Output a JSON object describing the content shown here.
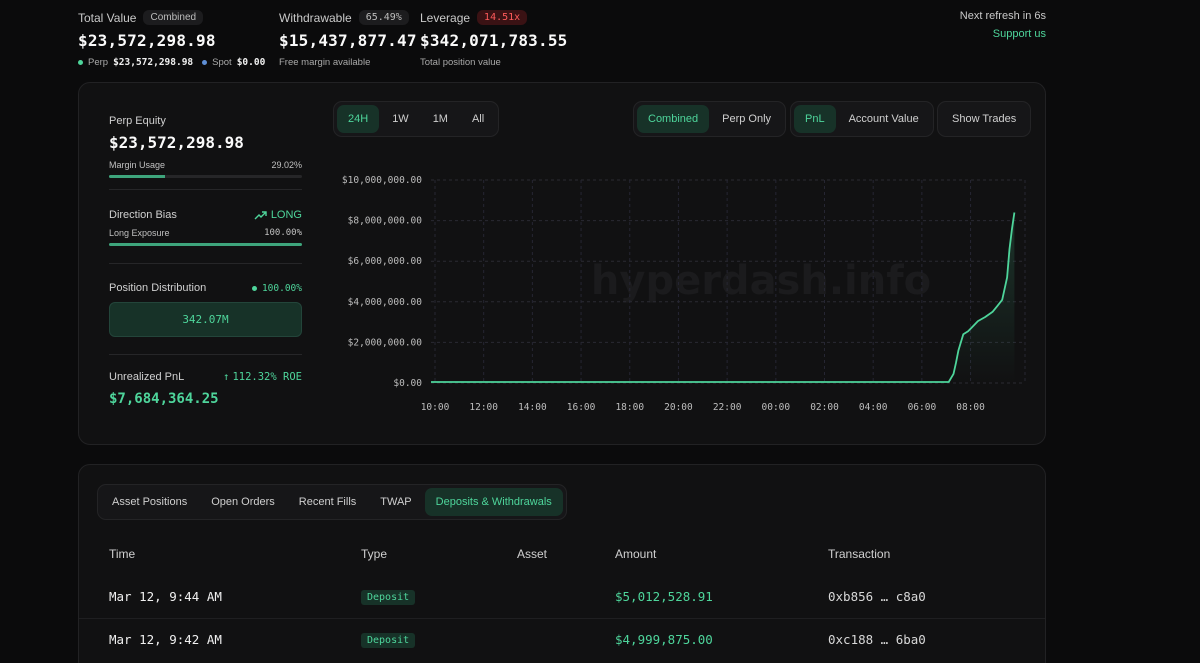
{
  "summary": {
    "total_value": {
      "label": "Total Value",
      "badge": "Combined",
      "value": "$23,572,298.98",
      "perp_label": "Perp",
      "perp_value": "$23,572,298.98",
      "spot_label": "Spot",
      "spot_value": "$0.00"
    },
    "withdrawable": {
      "label": "Withdrawable",
      "badge": "65.49%",
      "value": "$15,437,877.47",
      "sub": "Free margin available"
    },
    "leverage": {
      "label": "Leverage",
      "badge": "14.51x",
      "value": "$342,071,783.55",
      "sub": "Total position value"
    },
    "refresh": "Next refresh in 6s",
    "support": "Support us"
  },
  "equity": {
    "label": "Perp Equity",
    "value": "$23,572,298.98",
    "margin_label": "Margin Usage",
    "margin_value": "29.02%",
    "margin_fraction": 0.2902,
    "direction_label": "Direction Bias",
    "direction_value": "LONG",
    "exposure_label": "Long Exposure",
    "exposure_value": "100.00%",
    "exposure_fraction": 1.0,
    "distribution_label": "Position Distribution",
    "distribution_pct": "100.00%",
    "distribution_value": "342.07M",
    "upnl_label": "Unrealized PnL",
    "upnl_roe": "112.32% ROE",
    "upnl_value": "$7,684,364.25"
  },
  "chart_controls": {
    "ranges": [
      "24H",
      "1W",
      "1M",
      "All"
    ],
    "active_range": "24H",
    "scope": [
      "Combined",
      "Perp Only"
    ],
    "active_scope": "Combined",
    "metric": [
      "PnL",
      "Account Value"
    ],
    "active_metric": "PnL",
    "show_trades": "Show Trades"
  },
  "chart_data": {
    "type": "line",
    "watermark": "hyperdash.info",
    "x_ticks": [
      "10:00",
      "12:00",
      "14:00",
      "16:00",
      "18:00",
      "20:00",
      "22:00",
      "00:00",
      "02:00",
      "04:00",
      "06:00",
      "08:00"
    ],
    "y_ticks": [
      "$10,000,000.00",
      "$8,000,000.00",
      "$6,000,000.00",
      "$4,000,000.00",
      "$2,000,000.00",
      "$0.00"
    ],
    "ylim": [
      0,
      10000000
    ],
    "xlim_hours": [
      0,
      24
    ],
    "series": [
      {
        "color": "#4ed59b",
        "x": [
          0,
          21.1,
          21.3,
          21.4,
          21.5,
          21.7,
          21.9,
          22.1,
          22.3,
          22.6,
          22.9,
          23.1,
          23.3,
          23.5,
          23.6,
          23.7,
          23.8
        ],
        "values": [
          50000,
          50000,
          450000,
          1000000,
          1600000,
          2400000,
          2550000,
          2800000,
          3050000,
          3250000,
          3500000,
          3800000,
          4100000,
          5200000,
          6600000,
          7600000,
          8400000
        ]
      }
    ]
  },
  "bottom_tabs": {
    "items": [
      "Asset Positions",
      "Open Orders",
      "Recent Fills",
      "TWAP",
      "Deposits & Withdrawals"
    ],
    "active": "Deposits & Withdrawals"
  },
  "table": {
    "headers": [
      "Time",
      "Type",
      "Asset",
      "Amount",
      "Transaction"
    ],
    "rows": [
      {
        "time": "Mar 12, 9:44 AM",
        "type": "Deposit",
        "asset": "",
        "amount": "$5,012,528.91",
        "tx_start": "0xb856",
        "tx_end": "c8a0"
      },
      {
        "time": "Mar 12, 9:42 AM",
        "type": "Deposit",
        "asset": "",
        "amount": "$4,999,875.00",
        "tx_start": "0xc188",
        "tx_end": "6ba0"
      }
    ]
  }
}
